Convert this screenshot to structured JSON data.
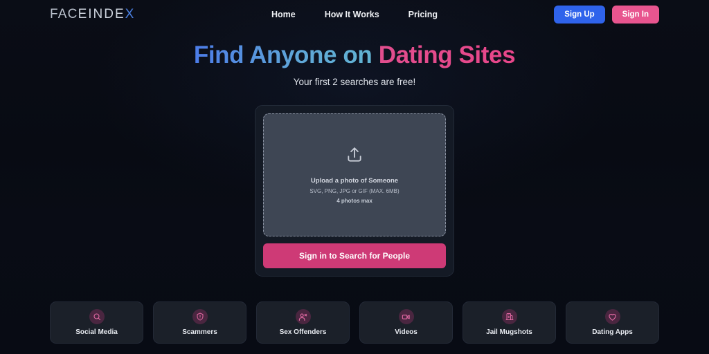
{
  "brand": {
    "logo_part1": "FAC",
    "logo_part2": "EINDE",
    "logo_part3": "X",
    "accent_blue": "#4a7fe0"
  },
  "nav": {
    "items": [
      {
        "label": "Home",
        "name": "nav-link-home"
      },
      {
        "label": "How It Works",
        "name": "nav-link-how-it-works"
      },
      {
        "label": "Pricing",
        "name": "nav-link-pricing"
      }
    ]
  },
  "auth": {
    "sign_up": "Sign Up",
    "sign_in": "Sign In",
    "sign_up_color": "#2f63eb",
    "sign_in_color": "#e8558f"
  },
  "hero": {
    "title_blue": "Find Anyone on ",
    "title_pink": "Dating Sites",
    "subtitle": "Your first 2 searches are free!"
  },
  "upload": {
    "icon": "upload-icon",
    "title": "Upload a photo of Someone",
    "formats": "SVG, PNG, JPG or GIF (MAX. 6MB)",
    "limit": "4 photos max",
    "cta_label": "Sign in to Search for People",
    "cta_color": "#ce3a76"
  },
  "categories": [
    {
      "label": "Social Media",
      "icon": "search-icon"
    },
    {
      "label": "Scammers",
      "icon": "shield-alert-icon"
    },
    {
      "label": "Sex Offenders",
      "icon": "user-x-icon"
    },
    {
      "label": "Videos",
      "icon": "video-camera-icon"
    },
    {
      "label": "Jail Mugshots",
      "icon": "building-icon"
    },
    {
      "label": "Dating Apps",
      "icon": "heart-icon"
    }
  ]
}
